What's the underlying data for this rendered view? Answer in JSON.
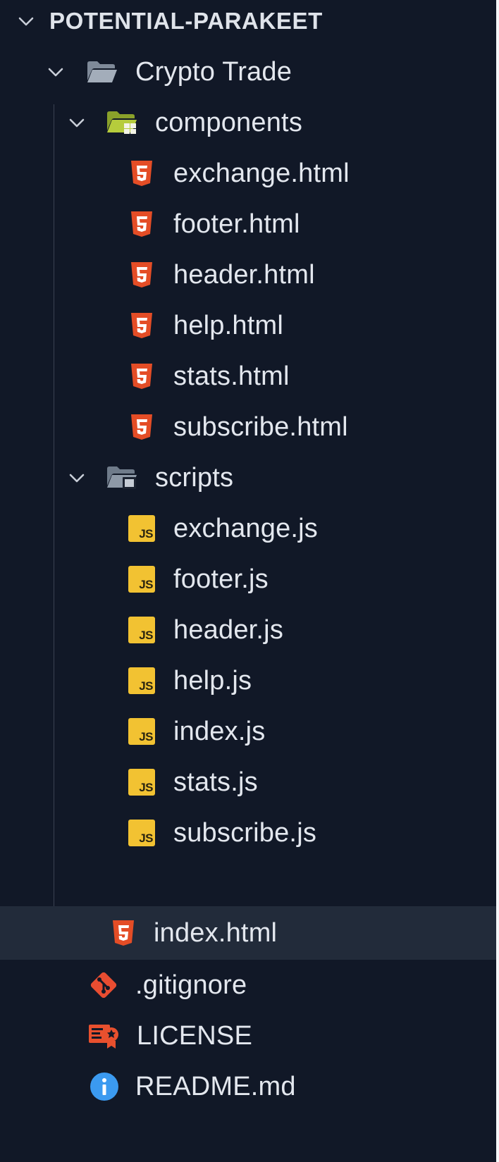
{
  "explorer": {
    "root": {
      "label": "POTENTIAL-PARAKEET",
      "icon": "chevron-down-icon"
    },
    "project_folder": {
      "label": "Crypto Trade",
      "icon": "folder-open-icon"
    },
    "components_folder": {
      "label": "components",
      "icon": "folder-components-icon"
    },
    "components_files": [
      {
        "label": "exchange.html",
        "icon": "html5-icon"
      },
      {
        "label": "footer.html",
        "icon": "html5-icon"
      },
      {
        "label": "header.html",
        "icon": "html5-icon"
      },
      {
        "label": "help.html",
        "icon": "html5-icon"
      },
      {
        "label": "stats.html",
        "icon": "html5-icon"
      },
      {
        "label": "subscribe.html",
        "icon": "html5-icon"
      }
    ],
    "scripts_folder": {
      "label": "scripts",
      "icon": "folder-scripts-icon"
    },
    "scripts_files": [
      {
        "label": "exchange.js",
        "icon": "javascript-icon"
      },
      {
        "label": "footer.js",
        "icon": "javascript-icon"
      },
      {
        "label": "header.js",
        "icon": "javascript-icon"
      },
      {
        "label": "help.js",
        "icon": "javascript-icon"
      },
      {
        "label": "index.js",
        "icon": "javascript-icon"
      },
      {
        "label": "stats.js",
        "icon": "javascript-icon"
      },
      {
        "label": "subscribe.js",
        "icon": "javascript-icon"
      }
    ],
    "project_files": [
      {
        "label": "index.html",
        "icon": "html5-icon",
        "selected": true
      }
    ],
    "root_files": [
      {
        "label": ".gitignore",
        "icon": "git-icon"
      },
      {
        "label": "LICENSE",
        "icon": "license-icon"
      },
      {
        "label": "README.md",
        "icon": "info-icon"
      }
    ],
    "js_badge": "JS",
    "colors": {
      "background": "#111827",
      "selected_row": "#222b3a",
      "html_icon": "#e44d26",
      "js_icon": "#f2c232",
      "git_icon": "#e84d31",
      "license_icon": "#e8502e",
      "info_icon": "#3b9af0",
      "folder_gray": "#8a96a6",
      "folder_green": "#a8c23a"
    }
  }
}
